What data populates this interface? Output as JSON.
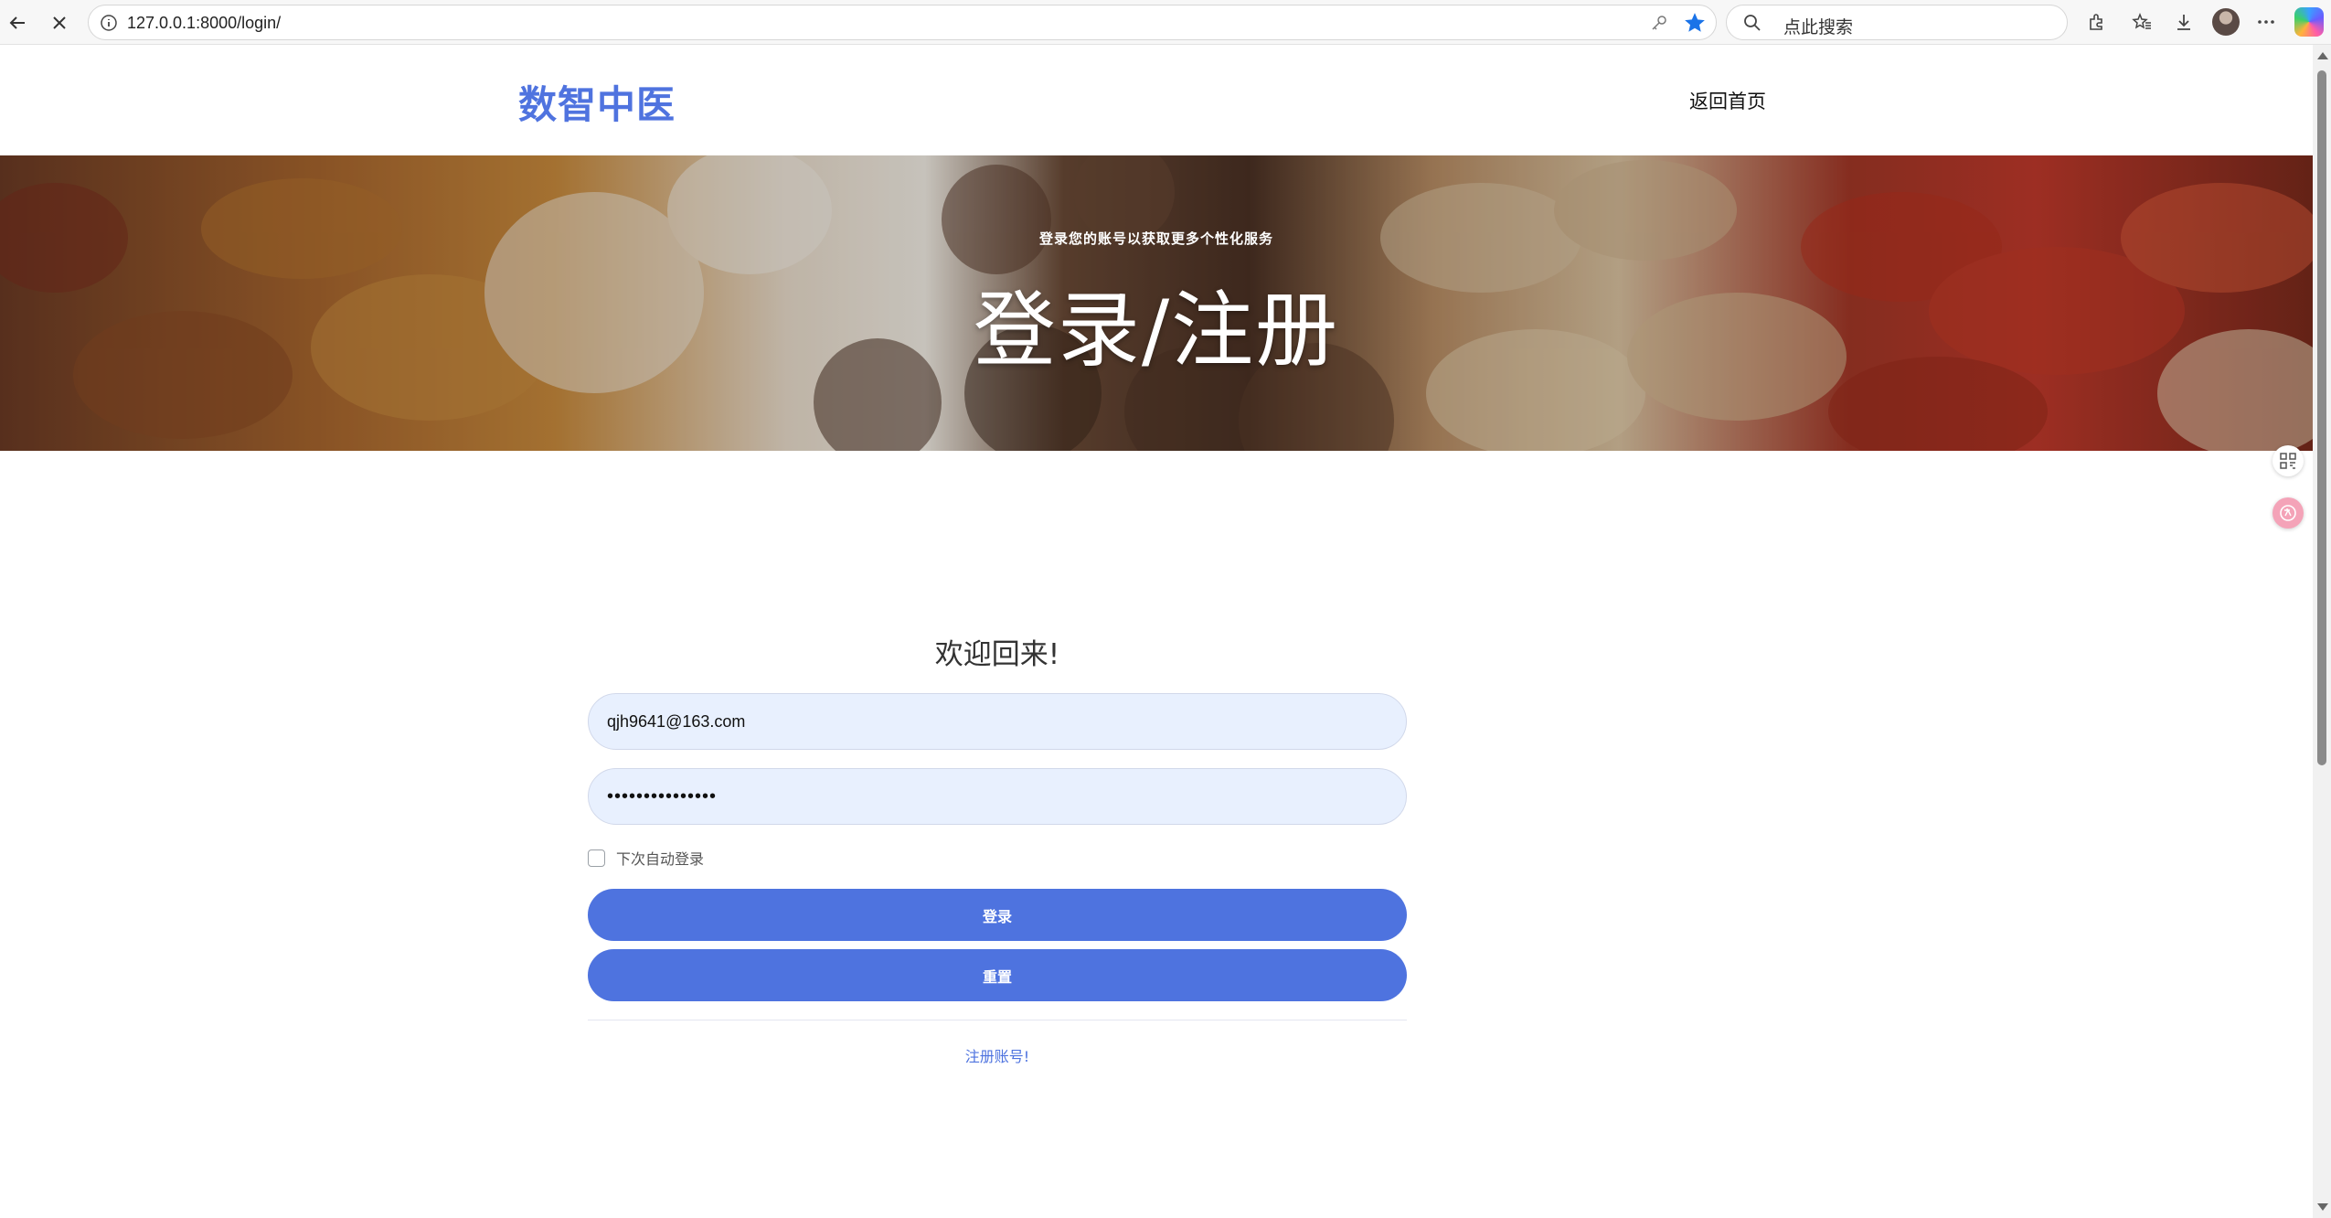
{
  "browser": {
    "url": "127.0.0.1:8000/login/",
    "search_placeholder": "点此搜索",
    "icons": [
      "back-icon",
      "stop-icon",
      "info-icon",
      "key-icon",
      "star-icon",
      "search-icon",
      "extensions-icon",
      "favorites-icon",
      "download-icon",
      "more-icon",
      "copilot-icon"
    ],
    "star_color": "#1a73e8"
  },
  "header": {
    "logo": "数智中医",
    "home_link": "返回首页",
    "brand_color": "#4f73df"
  },
  "hero": {
    "subtitle": "登录您的账号以获取更多个性化服务",
    "title": "登录/注册"
  },
  "form": {
    "welcome": "欢迎回来!",
    "email_value": "qjh9641@163.com",
    "password_value": "•••••••••••••••",
    "remember_label": "下次自动登录",
    "remember_checked": false,
    "login_button": "登录",
    "reset_button": "重置",
    "register_link": "注册账号!",
    "button_color": "#4e73df"
  }
}
